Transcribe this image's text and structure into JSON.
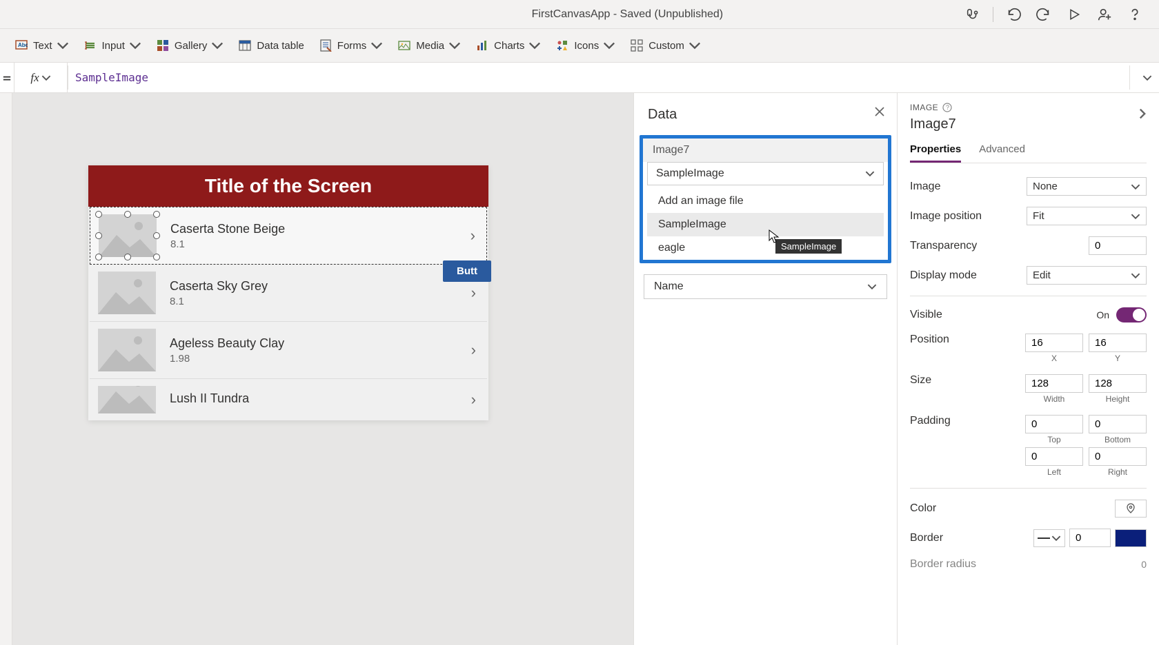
{
  "titlebar": {
    "title": "FirstCanvasApp - Saved (Unpublished)"
  },
  "toolbar": {
    "text": "Text",
    "input": "Input",
    "gallery": "Gallery",
    "datatable": "Data table",
    "forms": "Forms",
    "media": "Media",
    "charts": "Charts",
    "icons": "Icons",
    "custom": "Custom"
  },
  "formula": {
    "value": "SampleImage"
  },
  "canvas": {
    "title": "Title of the Screen",
    "button": "Butt",
    "items": [
      {
        "title": "Caserta Stone Beige",
        "sub": "8.1"
      },
      {
        "title": "Caserta Sky Grey",
        "sub": "8.1"
      },
      {
        "title": "Ageless Beauty Clay",
        "sub": "1.98"
      },
      {
        "title": "Lush II Tundra",
        "sub": ""
      }
    ]
  },
  "dataPanel": {
    "header": "Data",
    "fieldLabel": "Image7",
    "selected": "SampleImage",
    "options": [
      "Add an image file",
      "SampleImage",
      "eagle"
    ],
    "hover_index": 1,
    "tooltip": "SampleImage",
    "nameField": "Name"
  },
  "props": {
    "sectionLabel": "IMAGE",
    "name": "Image7",
    "tabs": {
      "properties": "Properties",
      "advanced": "Advanced"
    },
    "image": {
      "label": "Image",
      "value": "None"
    },
    "position_mode": {
      "label": "Image position",
      "value": "Fit"
    },
    "transparency": {
      "label": "Transparency",
      "value": "0"
    },
    "display_mode": {
      "label": "Display mode",
      "value": "Edit"
    },
    "visible": {
      "label": "Visible",
      "state": "On"
    },
    "position": {
      "label": "Position",
      "x": "16",
      "y": "16",
      "xlabel": "X",
      "ylabel": "Y"
    },
    "size": {
      "label": "Size",
      "w": "128",
      "h": "128",
      "wlabel": "Width",
      "hlabel": "Height"
    },
    "padding": {
      "label": "Padding",
      "top": "0",
      "bottom": "0",
      "left": "0",
      "right": "0",
      "toplabel": "Top",
      "bottomlabel": "Bottom",
      "leftlabel": "Left",
      "rightlabel": "Right"
    },
    "color": {
      "label": "Color"
    },
    "border": {
      "label": "Border",
      "value": "0"
    },
    "border_radius": {
      "label": "Border radius",
      "value": "0"
    }
  }
}
